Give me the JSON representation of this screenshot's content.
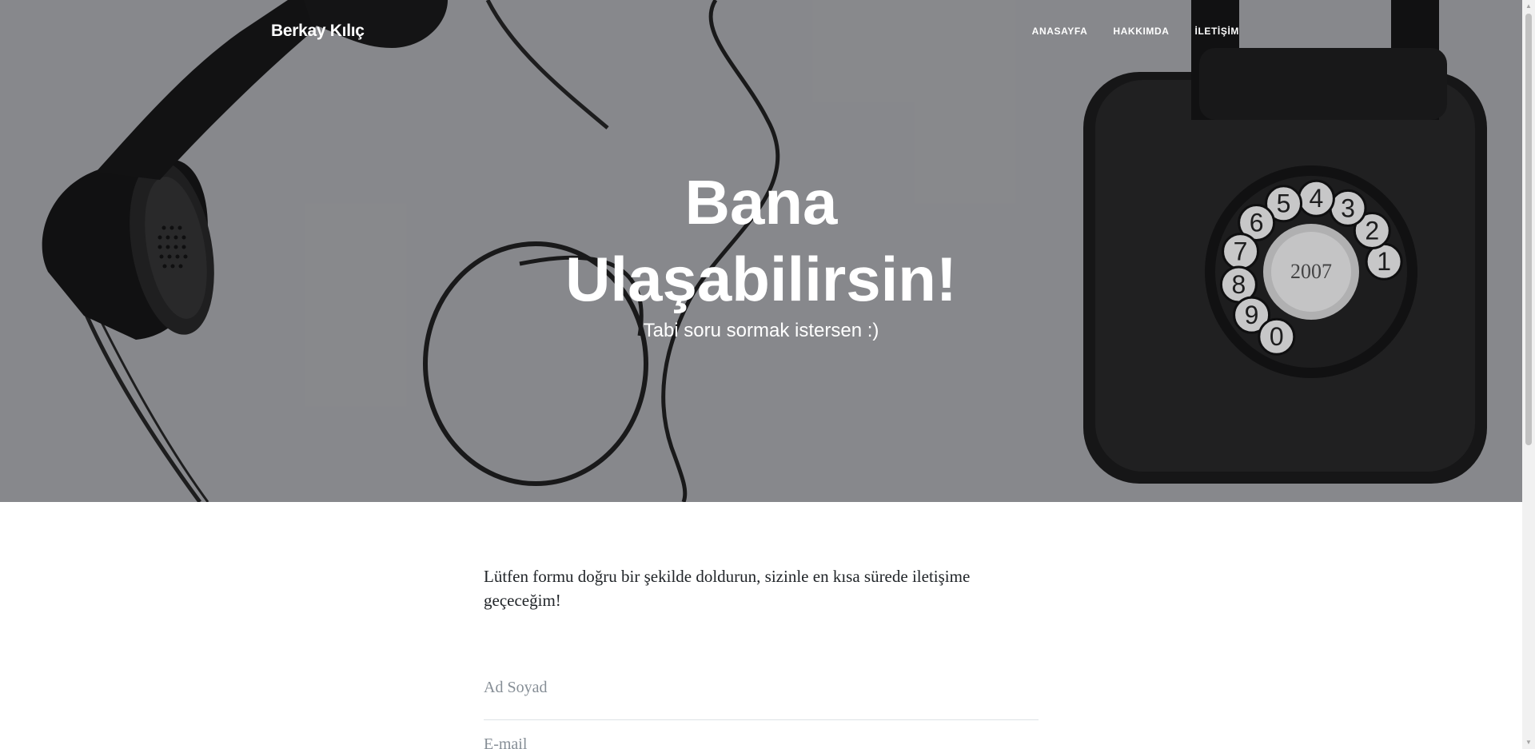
{
  "header": {
    "brand": "Berkay Kılıç",
    "nav": [
      "ANASAYFA",
      "HAKKIMDA",
      "İLETİŞİM"
    ]
  },
  "hero": {
    "title_line1": "Bana",
    "title_line2": "Ulaşabilirsin!",
    "subtitle": "Tabi soru sormak istersen :)",
    "dial_numbers": [
      "1",
      "2",
      "3",
      "4",
      "5",
      "6",
      "7",
      "8",
      "9",
      "0"
    ],
    "dial_center": "2007"
  },
  "main": {
    "intro": "Lütfen formu doğru bir şekilde doldurun, sizinle en kısa sürede iletişime geçeceğim!",
    "form": {
      "name_placeholder": "Ad Soyad",
      "email_placeholder": "E-mail"
    }
  },
  "colors": {
    "hero_bg": "#8d8e91",
    "text": "#212529",
    "placeholder": "#868e96"
  }
}
